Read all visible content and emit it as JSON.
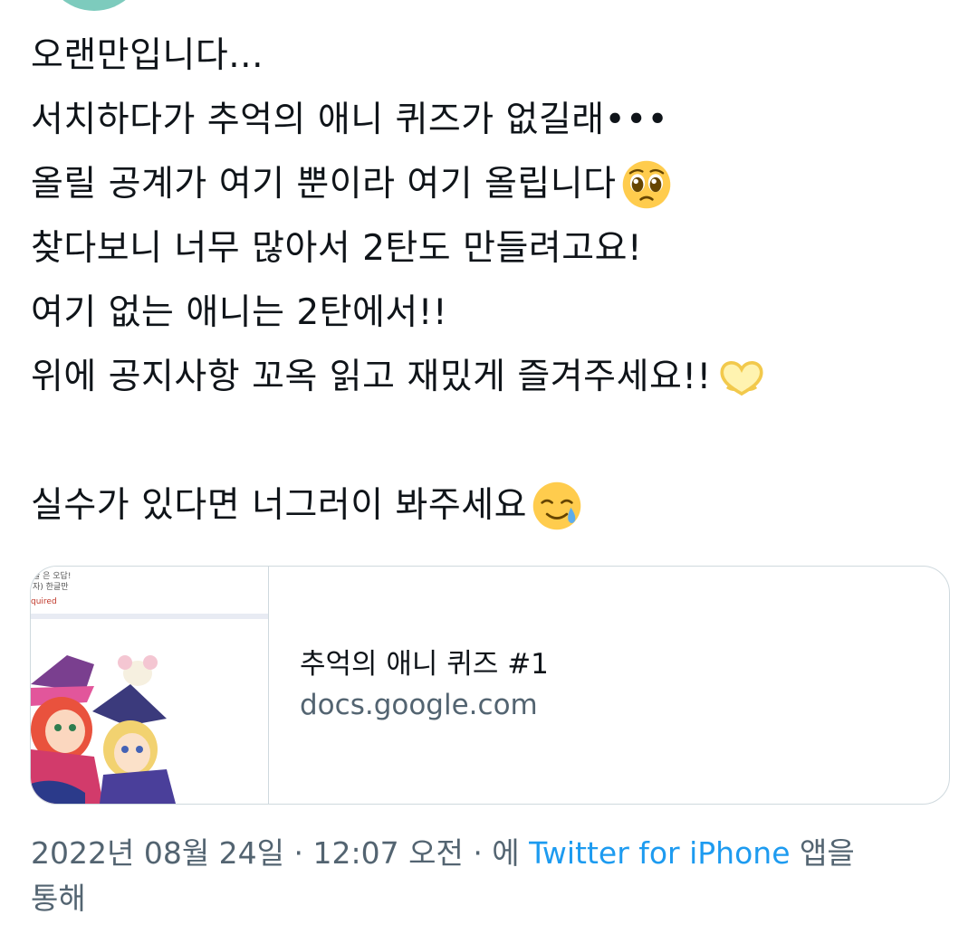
{
  "tweet": {
    "lines": [
      "오랜만입니다...",
      "서치하다가 추억의 애니 퀴즈가 없길래•••",
      "올릴 공계가 여기 뿐이라 여기 올립니다",
      "찾다보니 너무 많아서 2탄도 만들려고요!",
      "여기 없는 애니는 2탄에서!!",
      "위에 공지사항 꼬옥 읽고 재밌게 즐겨주세요!!",
      "",
      "실수가 있다면 너그러이 봐주세요"
    ],
    "emojis": {
      "line3": "pleading-face-icon",
      "line6": "heart-hands-icon",
      "line8": "smiling-face-with-tear-icon"
    }
  },
  "card": {
    "title": "추억의 애니 퀴즈 #1",
    "domain": "docs.google.com",
    "thumb_text": [
      "글 은 오답!",
      "자) 한글만",
      "quired"
    ]
  },
  "meta": {
    "date": "2022년 08월 24일",
    "sep1": " · ",
    "time": "12:07 오전",
    "sep2": " · 에 ",
    "source": "Twitter for iPhone",
    "suffix": " 앱을",
    "suffix2": "통해"
  },
  "colors": {
    "text": "#0f1419",
    "secondary": "#536471",
    "link": "#1d9bf0",
    "border": "#cfd9de"
  }
}
